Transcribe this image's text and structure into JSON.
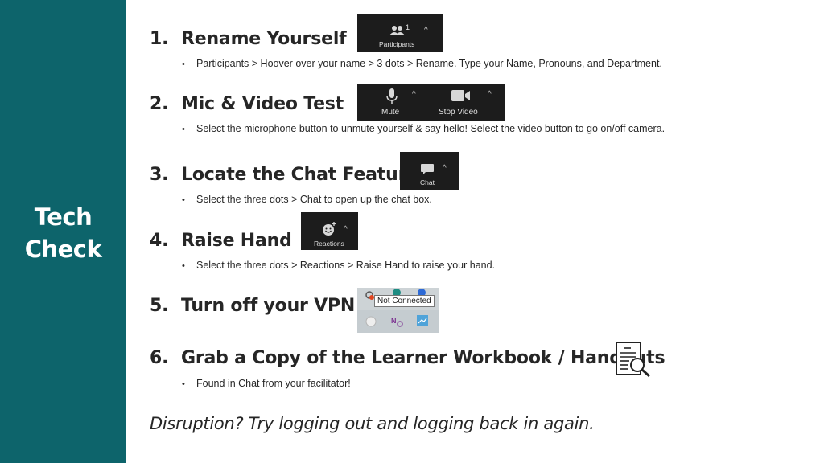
{
  "sidebar": {
    "title_line1": "Tech",
    "title_line2": "Check",
    "color": "#0d646b"
  },
  "steps": [
    {
      "number": "1.",
      "title": "Rename Yourself",
      "bullet": "Participants > Hoover over your name > 3 dots > Rename. Type your Name, Pronouns, and Department.",
      "screenshot": {
        "icon": "participants-icon",
        "label": "Participants",
        "count": "1",
        "caret": "^"
      }
    },
    {
      "number": "2.",
      "title": "Mic & Video Test",
      "bullet": "Select the microphone button to unmute yourself & say hello! Select the video button to go on/off camera.",
      "screenshot": {
        "buttons": [
          {
            "icon": "microphone-icon",
            "label": "Mute",
            "caret": "^"
          },
          {
            "icon": "video-camera-icon",
            "label": "Stop Video",
            "caret": "^"
          }
        ]
      }
    },
    {
      "number": "3.",
      "title": "Locate the Chat Feature",
      "bullet": "Select the three dots > Chat to open up the chat box.",
      "screenshot": {
        "icon": "chat-bubble-icon",
        "label": "Chat",
        "caret": "^"
      }
    },
    {
      "number": "4.",
      "title": "Raise Hand",
      "bullet": "Select the three dots > Reactions > Raise Hand to raise your hand.",
      "screenshot": {
        "icon": "smiley-plus-icon",
        "label": "Reactions",
        "caret": "^"
      }
    },
    {
      "number": "5.",
      "title": "Turn off your VPN",
      "screenshot": {
        "tooltip": "Not Connected",
        "icons": [
          "vpn-icon",
          "app-icon",
          "zoom-tray-icon",
          "globe-icon",
          "onenote-icon",
          "network-icon"
        ]
      }
    },
    {
      "number": "6.",
      "title": "Grab a Copy of the Learner Workbook / Handouts",
      "bullet": "Found in Chat from your facilitator!",
      "icon": "document-search-icon"
    }
  ],
  "footer_note": "Disruption? Try logging out and logging back in again."
}
